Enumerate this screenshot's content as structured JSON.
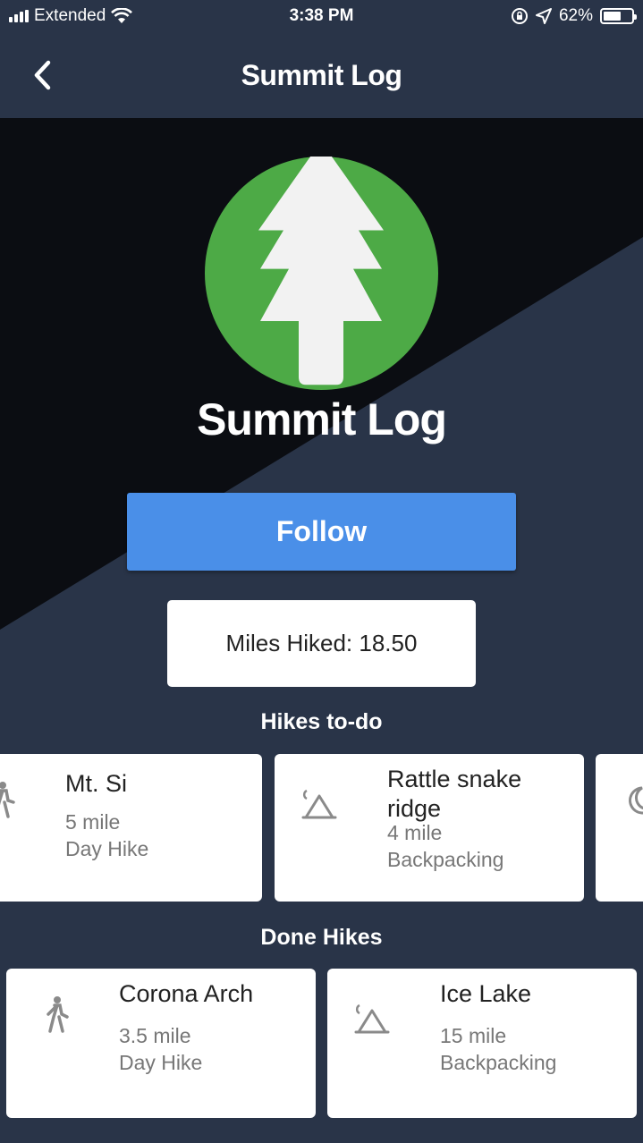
{
  "status_bar": {
    "carrier": "Extended",
    "time": "3:38 PM",
    "battery_percent": "62%",
    "battery_level": 0.62
  },
  "nav": {
    "title": "Summit Log",
    "back_icon": "chevron-left-icon"
  },
  "profile": {
    "name": "Summit Log",
    "logo_icon": "pine-tree-icon",
    "follow_label": "Follow",
    "miles_text": "Miles Hiked: 18.50"
  },
  "colors": {
    "background": "#293448",
    "hero_dark": "#0b0d12",
    "accent_blue": "#4a8fe8",
    "logo_green": "#4daa46"
  },
  "todo": {
    "title": "Hikes to-do",
    "items": [
      {
        "name": "Mt. Si",
        "distance": "5 mile",
        "type": "Day Hike",
        "icon": "hiker-icon"
      },
      {
        "name": "Rattle snake ridge",
        "distance": "4 mile",
        "type": "Backpacking",
        "icon": "tent-icon"
      },
      {
        "name": "",
        "distance": "",
        "type": "",
        "icon": "moon-icon"
      }
    ]
  },
  "done": {
    "title": "Done Hikes",
    "items": [
      {
        "name": "Corona Arch",
        "distance": "3.5 mile",
        "type": "Day Hike",
        "icon": "hiker-icon"
      },
      {
        "name": "Ice Lake",
        "distance": "15 mile",
        "type": "Backpacking",
        "icon": "tent-icon"
      }
    ]
  }
}
